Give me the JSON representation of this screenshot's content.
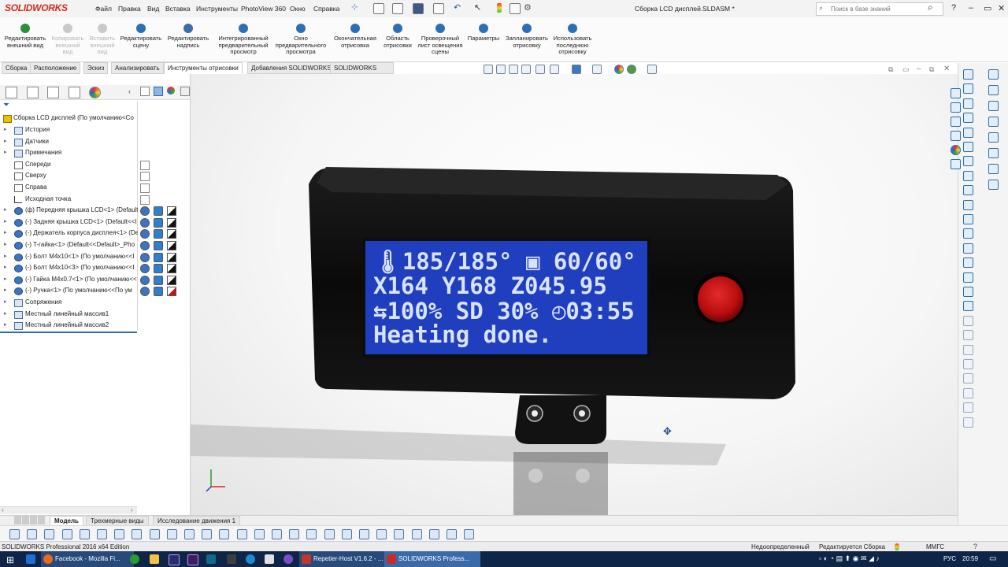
{
  "app": {
    "logo_text": "SOLIDWORKS",
    "document_title": "Сборка LCD дисплей.SLDASM *",
    "edition": "SOLIDWORKS Professional 2016 x64 Edition"
  },
  "menu": [
    "Файл",
    "Правка",
    "Вид",
    "Вставка",
    "Инструменты",
    "PhotoView 360",
    "Окно",
    "Справка"
  ],
  "search": {
    "placeholder": "Поиск в базе знаний"
  },
  "ribbon": {
    "buttons": [
      {
        "label": "Редактировать\nвнешний вид",
        "enabled": true,
        "icon": "appearance-icon",
        "color": "#2c8f3a"
      },
      {
        "label": "Копировать\nвнешний\nвид",
        "enabled": false,
        "icon": "copy-appearance-icon",
        "color": "#c9c9c9"
      },
      {
        "label": "Вставить\nвнешний\nвид",
        "enabled": false,
        "icon": "paste-appearance-icon",
        "color": "#c9c9c9"
      },
      {
        "label": "Редактировать\nсцену",
        "enabled": true,
        "icon": "scene-icon",
        "color": "#2d6fb6"
      },
      {
        "label": "Редактировать\nнадпись",
        "enabled": true,
        "icon": "decal-icon",
        "color": "#3a6ea8"
      },
      {
        "label": "Интегрированный\nпредварительный\nпросмотр",
        "enabled": true,
        "icon": "integrated-preview-icon",
        "color": "#2d6fb6"
      },
      {
        "label": "Окно\nпредварительного\nпросмотра",
        "enabled": true,
        "icon": "preview-window-icon",
        "color": "#2d6fb6"
      },
      {
        "label": "Окончательная\nотрисовка",
        "enabled": true,
        "icon": "final-render-icon",
        "color": "#2d6fb6"
      },
      {
        "label": "Область\nотрисовки",
        "enabled": true,
        "icon": "render-region-icon",
        "color": "#2d6fb6"
      },
      {
        "label": "Проверочный\nлист освещения\nсцены",
        "enabled": true,
        "icon": "lighting-proof-icon",
        "color": "#2d6fb6"
      },
      {
        "label": "Параметры",
        "enabled": true,
        "icon": "options-icon",
        "color": "#2d6fb6"
      },
      {
        "label": "Запланировать\nотрисовку",
        "enabled": true,
        "icon": "schedule-render-icon",
        "color": "#2d6fb6"
      },
      {
        "label": "Использовать\nпоследнюю\nотрисовку",
        "enabled": true,
        "icon": "last-render-icon",
        "color": "#2d6fb6"
      }
    ]
  },
  "command_tabs": [
    "Сборка",
    "Расположение",
    "Эскиз",
    "Анализировать",
    "Инструменты отрисовки",
    "Добавления SOLIDWORKS",
    "SOLIDWORKS MBD"
  ],
  "active_command_tab": "Инструменты отрисовки",
  "tree": {
    "root": "Сборка LCD дисплей  (По умолчанию<Со",
    "items": [
      {
        "label": "История",
        "icon": "history-icon",
        "type": "folder",
        "expandable": true
      },
      {
        "label": "Датчики",
        "icon": "sensor-icon",
        "type": "folder",
        "expandable": true
      },
      {
        "label": "Примечания",
        "icon": "annotation-icon",
        "type": "folder",
        "expandable": true
      },
      {
        "label": "Спереди",
        "icon": "plane-icon",
        "type": "plane",
        "expandable": false
      },
      {
        "label": "Сверху",
        "icon": "plane-icon",
        "type": "plane",
        "expandable": false
      },
      {
        "label": "Справа",
        "icon": "plane-icon",
        "type": "plane",
        "expandable": false
      },
      {
        "label": "Исходная точка",
        "icon": "origin-icon",
        "type": "origin",
        "expandable": false
      },
      {
        "label": "(ф) Передняя крышка LCD<1> (Default",
        "icon": "part-icon",
        "type": "part",
        "expandable": true
      },
      {
        "label": "(-) Задняя крышка LCD<1> (Default<<I",
        "icon": "part-icon",
        "type": "part",
        "expandable": true
      },
      {
        "label": "(-) Держатель корпуса дисплея<1> (De",
        "icon": "part-icon",
        "type": "part",
        "expandable": true
      },
      {
        "label": "(-) T-гайка<1> (Default<<Default>_Pho",
        "icon": "part-icon",
        "type": "part",
        "expandable": true
      },
      {
        "label": "(-) Болт M4x10<1> (По умолчанию<<I",
        "icon": "part-icon",
        "type": "part",
        "expandable": true
      },
      {
        "label": "(-) Болт M4x10<3> (По умолчанию<<I",
        "icon": "part-icon",
        "type": "part",
        "expandable": true
      },
      {
        "label": "(-) Гайка M4x0.7<1> (По умолчанию<<",
        "icon": "part-icon",
        "type": "part",
        "expandable": true
      },
      {
        "label": "(-) Ручка<1> (По умолчанию<<По ум",
        "icon": "part-icon",
        "type": "part",
        "expandable": true
      },
      {
        "label": "Сопряжения",
        "icon": "mates-icon",
        "type": "folder",
        "expandable": true
      },
      {
        "label": "Местный линейный массив1",
        "icon": "pattern-icon",
        "type": "folder",
        "expandable": true
      },
      {
        "label": "Местный линейный массив2",
        "icon": "pattern-icon",
        "type": "folder",
        "expandable": true
      }
    ]
  },
  "lcd": {
    "line1": "🌡185/185°  ▣ 60/60°",
    "line2": "X164 Y168   Z045.95",
    "line3": "⇆100%  SD 30% ◴03:55",
    "line4": "Heating done.",
    "screen_color": "#1f3fbf",
    "text_color": "#d9e2ff",
    "knob_color": "#c41414"
  },
  "bottom_tabs": [
    "Модель",
    "Трехмерные виды",
    "Исследование движения 1"
  ],
  "active_bottom_tab": "Модель",
  "status": {
    "edition": "SOLIDWORKS Professional 2016 x64 Edition",
    "definition": "Недоопределенный",
    "mode": "Редактируется Сборка",
    "units": "ММГС"
  },
  "taskbar": {
    "apps": [
      "Facebook - Mozilla Fi...",
      "Repetier-Host V1.6.2 - ...",
      "SOLIDWORKS Profess..."
    ],
    "language": "РУС",
    "time": "20:59"
  }
}
